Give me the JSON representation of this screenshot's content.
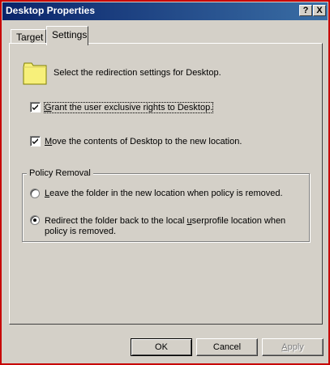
{
  "window": {
    "title": "Desktop Properties",
    "help_label": "?",
    "close_label": "X"
  },
  "tabs": [
    {
      "label": "Target",
      "active": false
    },
    {
      "label": "Settings",
      "active": true
    }
  ],
  "settings": {
    "intro": "Select the redirection settings for Desktop.",
    "icon": "folder-icon",
    "grant_rights": {
      "label_pre": "",
      "label_mnemonic": "G",
      "label_post": "rant the user exclusive rights to Desktop.",
      "checked": true
    },
    "move_contents": {
      "label_pre": "",
      "label_mnemonic": "M",
      "label_post": "ove the contents of Desktop to the new location.",
      "checked": true
    }
  },
  "policy_removal": {
    "legend": "Policy Removal",
    "leave_option": {
      "label_pre": "",
      "label_mnemonic": "L",
      "label_post": "eave the folder in the new location when policy is removed.",
      "selected": false
    },
    "redirect_option": {
      "line1_pre": "Redirect the folder back to the local ",
      "line1_mnemonic": "u",
      "line1_post": "serprofile location when",
      "line2": "policy is removed.",
      "selected": true
    }
  },
  "buttons": {
    "ok": "OK",
    "cancel": "Cancel",
    "apply_mnemonic": "A",
    "apply_rest": "pply"
  },
  "colors": {
    "face": "#d4d0c8",
    "titlebar": "#0a246a",
    "frame_border": "#c80000",
    "folder": "#f7f07a"
  }
}
